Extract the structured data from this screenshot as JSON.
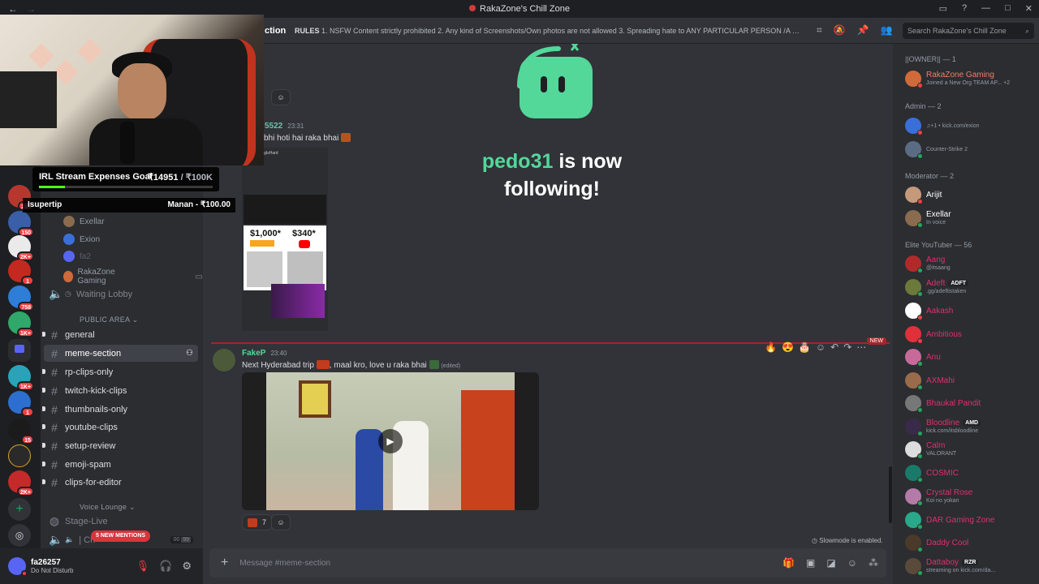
{
  "window": {
    "title": "RakaZone's Chill Zone"
  },
  "servers": {
    "badges": [
      "285",
      "150",
      "2K+",
      "1",
      "758",
      "1K+",
      "1K+",
      "1",
      "15",
      "2K+"
    ]
  },
  "stream_overlay": {
    "goal_label": "IRL Stream Expenses Goal",
    "goal_current": "₹14951",
    "goal_target": "/ ₹100K",
    "goal_progress": 0.1495,
    "tip_user": "Isupertip",
    "tip_text": "Manan - ₹100.00"
  },
  "channels": {
    "voice_users": [
      {
        "name": "Exellar",
        "color": "#8a6b4e"
      },
      {
        "name": "Exion",
        "color": "#3a6fd8"
      },
      {
        "name": "fa2",
        "color": "#5865f2"
      },
      {
        "name": "RakaZone Gaming",
        "color": "#d06a3a"
      }
    ],
    "waiting_lobby": "Waiting Lobby",
    "category_public": "PUBLIC AREA",
    "list": [
      "general",
      "meme-section",
      "rp-clips-only",
      "twitch-kick-clips",
      "thumbnails-only",
      "youtube-clips",
      "setup-review",
      "emoji-spam",
      "clips-for-editor"
    ],
    "active": "meme-section",
    "category_voice": "Voice Lounge",
    "stage": "Stage-Live",
    "voice_partial": "| Ch",
    "voice_counts": [
      "00",
      "99"
    ],
    "new_mentions": "5 NEW MENTIONS"
  },
  "user": {
    "name": "fa26257",
    "status": "Do Not Disturb"
  },
  "header": {
    "channel_partial": "ction",
    "topic_label": "RULES",
    "topic": "1. NSFW Content strictly prohibited 2. Any kind of Screenshots/Own photos are not allowed 3. Spreading hate to ANY PARTICULAR PERSON /A GR...",
    "search_placeholder": "Search RakaZone's Chill Zone"
  },
  "follow_alert": {
    "who": "pedo31",
    "text1": " is now",
    "text2": "following!"
  },
  "messages": [
    {
      "user": "5522",
      "time": "23:31",
      "text": "i bhi hoti hai raka bhai",
      "embed": {
        "title": "r/CensoringIsHard",
        "price1": "$1,000*",
        "price2": "$340*"
      }
    },
    {
      "user": "FakeP",
      "time": "23:40",
      "text_a": "Next Hyderabad trip",
      "text_b": ", maal kro, love u raka bhai",
      "edited": "(edited)",
      "reaction_count": "7",
      "new_tag": "NEW"
    }
  ],
  "composer": {
    "placeholder": "Message #meme-section",
    "slowmode": "Slowmode is enabled."
  },
  "members": {
    "owner": {
      "label": "||OWNER|| — 1",
      "name": "RakaZone Gaming",
      "activity": "Joined a New Org TEAM AP...",
      "extra": "+2",
      "color": "#f47b67"
    },
    "admin_label": "Admin — 2",
    "admins": [
      {
        "name": "",
        "activity": "♫+1 • kick.com/exion",
        "color": "#3a6fd8"
      },
      {
        "name": "",
        "activity": "Counter-Strike 2",
        "color": "#5a6c84"
      }
    ],
    "mod_label": "Moderator — 2",
    "mods": [
      {
        "name": "Arijit",
        "activity": "",
        "color": "#c49a7a"
      },
      {
        "name": "Exellar",
        "activity": "In voice",
        "color": "#8a6b4e"
      }
    ],
    "elite_label": "Elite YouTuber — 56",
    "elite": [
      {
        "name": "Aang",
        "activity": "@itsaang",
        "color": "#b12a2a",
        "tag": ""
      },
      {
        "name": "Adeft",
        "activity": ".gg/adeftistaken",
        "color": "#6b7a3a",
        "tag": "ADFT"
      },
      {
        "name": "Aakash",
        "activity": "",
        "color": "#ffffff",
        "tag": ""
      },
      {
        "name": "Ambitious",
        "activity": "",
        "color": "#e0313b",
        "tag": ""
      },
      {
        "name": "Anu",
        "activity": "",
        "color": "#c76a9a",
        "tag": ""
      },
      {
        "name": "AXMahi",
        "activity": "",
        "color": "#9a6b4a",
        "tag": ""
      },
      {
        "name": "Bhaukal Pandit",
        "activity": "",
        "color": "#777777",
        "tag": ""
      },
      {
        "name": "Bloodline",
        "activity": "kick.com/itsbloodline",
        "color": "#3a2a4a",
        "tag": "AMD"
      },
      {
        "name": "Calm",
        "activity": "VALORANT",
        "color": "#dddddd",
        "tag": ""
      },
      {
        "name": "COSMIC",
        "activity": "",
        "color": "#1a7a6a",
        "tag": ""
      },
      {
        "name": "Crystal Rose",
        "activity": "Koi no yokan",
        "color": "#b47aa8",
        "tag": ""
      },
      {
        "name": "DAR Gaming Zone",
        "activity": "",
        "color": "#2aa88a",
        "tag": ""
      },
      {
        "name": "Daddy Cool",
        "activity": "",
        "color": "#4a3a2a",
        "tag": ""
      },
      {
        "name": "Dattaboy",
        "activity": "streaming on kick.com/da...",
        "color": "#5a4a3a",
        "tag": "RZR"
      }
    ]
  },
  "colors": {
    "accent": "#5865f2",
    "online": "#23a55a",
    "dnd": "#f23f43",
    "idle": "#f0b232",
    "kick_green": "#53fc18",
    "elite_name": "#e02f6b"
  }
}
